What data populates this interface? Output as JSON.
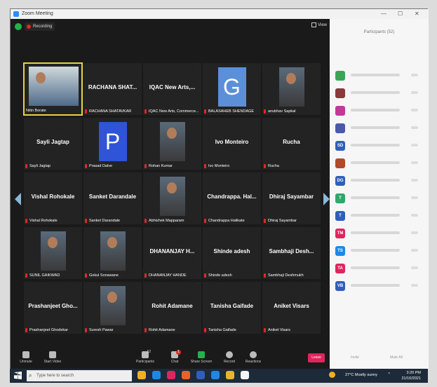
{
  "window": {
    "title": "Zoom Meeting",
    "controls": [
      "—",
      "☐",
      "✕"
    ]
  },
  "topbar": {
    "recording": "Recording",
    "view": "View"
  },
  "tiles": [
    {
      "name": "",
      "caption": "Nitin Borate",
      "type": "video",
      "active": true
    },
    {
      "name": "RACHANA SHAT...",
      "caption": "RACHANA SHATAVKAR",
      "type": "name"
    },
    {
      "name": "IQAC New Arts,...",
      "caption": "IQAC New Arts, Commerce...",
      "type": "name"
    },
    {
      "name": "",
      "caption": "BALASAHEB SHENDAGE",
      "type": "letter",
      "letter": "G",
      "color": "#5b8fd8"
    },
    {
      "name": "",
      "caption": "anubhav Sapkal",
      "type": "video"
    },
    {
      "name": "Sayli Jagtap",
      "caption": "Sayli Jagtap",
      "type": "name"
    },
    {
      "name": "",
      "caption": "Prasad Dalve",
      "type": "letter",
      "letter": "P",
      "color": "#2f54d8"
    },
    {
      "name": "",
      "caption": "Rohan Kumar",
      "type": "video"
    },
    {
      "name": "Ivo Monteiro",
      "caption": "Ivo Monteiro",
      "type": "name"
    },
    {
      "name": "Rucha",
      "caption": "Rucha",
      "type": "name"
    },
    {
      "name": "Vishal Rohokale",
      "caption": "Vishal Rohokale",
      "type": "name"
    },
    {
      "name": "Sanket Darandale",
      "caption": "Sanket Darandale",
      "type": "name"
    },
    {
      "name": "",
      "caption": "Abhishek Mapparam",
      "type": "video"
    },
    {
      "name": "Chandrappa. Hal...",
      "caption": "Chandrappa Halikate",
      "type": "name"
    },
    {
      "name": "Dhiraj Sayambar",
      "caption": "Dhiraj Sayambar",
      "type": "name"
    },
    {
      "name": "",
      "caption": "SUNIL GAIKWAD",
      "type": "video"
    },
    {
      "name": "",
      "caption": "Gokul Sonawane",
      "type": "video"
    },
    {
      "name": "DHANANJAY H...",
      "caption": "DHANANJAY HANDE",
      "type": "name"
    },
    {
      "name": "Shinde adesh",
      "caption": "Shinde adesh",
      "type": "name"
    },
    {
      "name": "Sambhaji Desh...",
      "caption": "Sambhaji Deshmukh",
      "type": "name"
    },
    {
      "name": "Prashanjeet Gho...",
      "caption": "Prashanjeet Ghodekar",
      "type": "name"
    },
    {
      "name": "",
      "caption": "Suresh Pawar",
      "type": "video"
    },
    {
      "name": "Rohit Adamane",
      "caption": "Rohit Adamane",
      "type": "name"
    },
    {
      "name": "Tanisha Gaifade",
      "caption": "Tanisha Gaifade",
      "type": "name"
    },
    {
      "name": "Aniket Visars",
      "caption": "Aniket Visars",
      "type": "name"
    }
  ],
  "controls": {
    "unmute": "Unmute",
    "start_video": "Start Video",
    "participants": "Participants",
    "participants_count": "52",
    "chat": "Chat",
    "chat_badge": "1",
    "share_screen": "Share Screen",
    "record": "Record",
    "reactions": "Reactions",
    "end": "Leave"
  },
  "panel": {
    "title": "Participants (52)",
    "participants": [
      {
        "initials": "",
        "color": "#3aa655"
      },
      {
        "initials": "",
        "color": "#8a3a3a"
      },
      {
        "initials": "",
        "color": "#c13a9a"
      },
      {
        "initials": "",
        "color": "#4a5aa8"
      },
      {
        "initials": "SD",
        "color": "#2f5fb8"
      },
      {
        "initials": "",
        "color": "#b04a2a"
      },
      {
        "initials": "DG",
        "color": "#2f5fb8"
      },
      {
        "initials": "T",
        "color": "#2fa86a"
      },
      {
        "initials": "T",
        "color": "#2f5fb8"
      },
      {
        "initials": "TM",
        "color": "#e0245e"
      },
      {
        "initials": "TS",
        "color": "#1e88e5"
      },
      {
        "initials": "TA",
        "color": "#e0245e"
      },
      {
        "initials": "VB",
        "color": "#2f5fb8"
      }
    ],
    "foot_left": "Invite",
    "foot_right": "Mute All"
  },
  "taskbar": {
    "search_placeholder": "Type here to search",
    "weather": "27°C  Mostly sunny",
    "time": "3:20 PM",
    "date": "21/10/2021",
    "apps": [
      "#f2b01e",
      "#1e88e5",
      "#e0245e",
      "#e8632a",
      "#2f5fb8",
      "#1e88e5",
      "#e8b52a",
      "#f4f4f4"
    ]
  }
}
